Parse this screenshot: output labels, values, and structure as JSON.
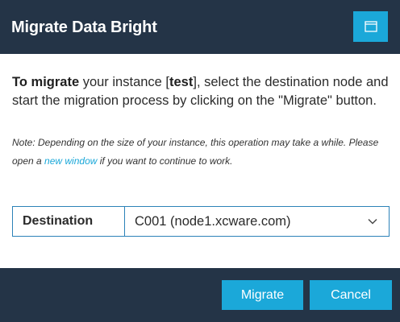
{
  "dialog": {
    "title": "Migrate Data Bright",
    "header_icons": {
      "maximize": "maximize-window-icon"
    }
  },
  "intro": {
    "lead_bold": "To migrate",
    "text_1": " your instance [",
    "instance": "test",
    "text_2": "], select the destination node and start the migration process by clicking on the \"Migrate\" button."
  },
  "note": {
    "text_1": "Note: Depending on the size of your instance, this operation may take a while. Please open a ",
    "link": "new window",
    "text_2": " if you want to continue to work."
  },
  "destination": {
    "label": "Destination",
    "selected": "C001 (node1.xcware.com)",
    "icon": "chevron-down-icon"
  },
  "footer": {
    "migrate_label": "Migrate",
    "cancel_label": "Cancel"
  },
  "colors": {
    "header_bg": "#243447",
    "accent": "#1ba8d9",
    "border": "#2c82b8",
    "text": "#2b2b2b"
  }
}
